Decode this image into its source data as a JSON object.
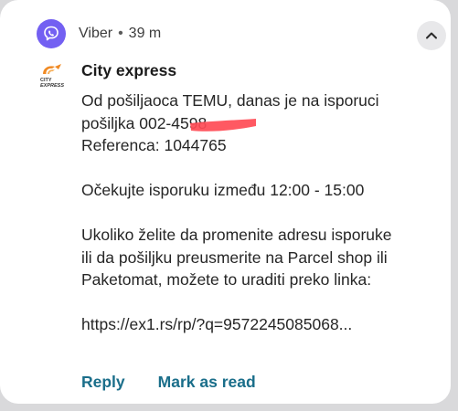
{
  "notification": {
    "app_name": "Viber",
    "separator": "•",
    "time": "39 m",
    "app_icon": "viber-icon",
    "collapse_icon": "chevron-up-icon",
    "sender": "City express",
    "sender_logo": {
      "text_top": "CITY",
      "text_bottom": "EXPRESS"
    },
    "message_lines": {
      "l1": "Od pošiljaoca TEMU, danas je na isporuci",
      "l2": "pošiljka 002-4598",
      "l3": "Referenca: 1044765",
      "l4": "Očekujte isporuku između 12:00 - 15:00",
      "l5": "Ukoliko želite da promenite adresu isporuke",
      "l6": "ili da pošiljku preusmerite na Parcel shop ili",
      "l7": "Paketomat, možete to uraditi preko linka:",
      "l8": "https://ex1.rs/rp/?q=9572245085068..."
    },
    "actions": {
      "reply": "Reply",
      "mark_as_read": "Mark as read"
    },
    "colors": {
      "viber": "#7360f2",
      "action": "#1a6e8a",
      "redaction": "#ff4b55",
      "logo_orange": "#f08a24"
    }
  }
}
